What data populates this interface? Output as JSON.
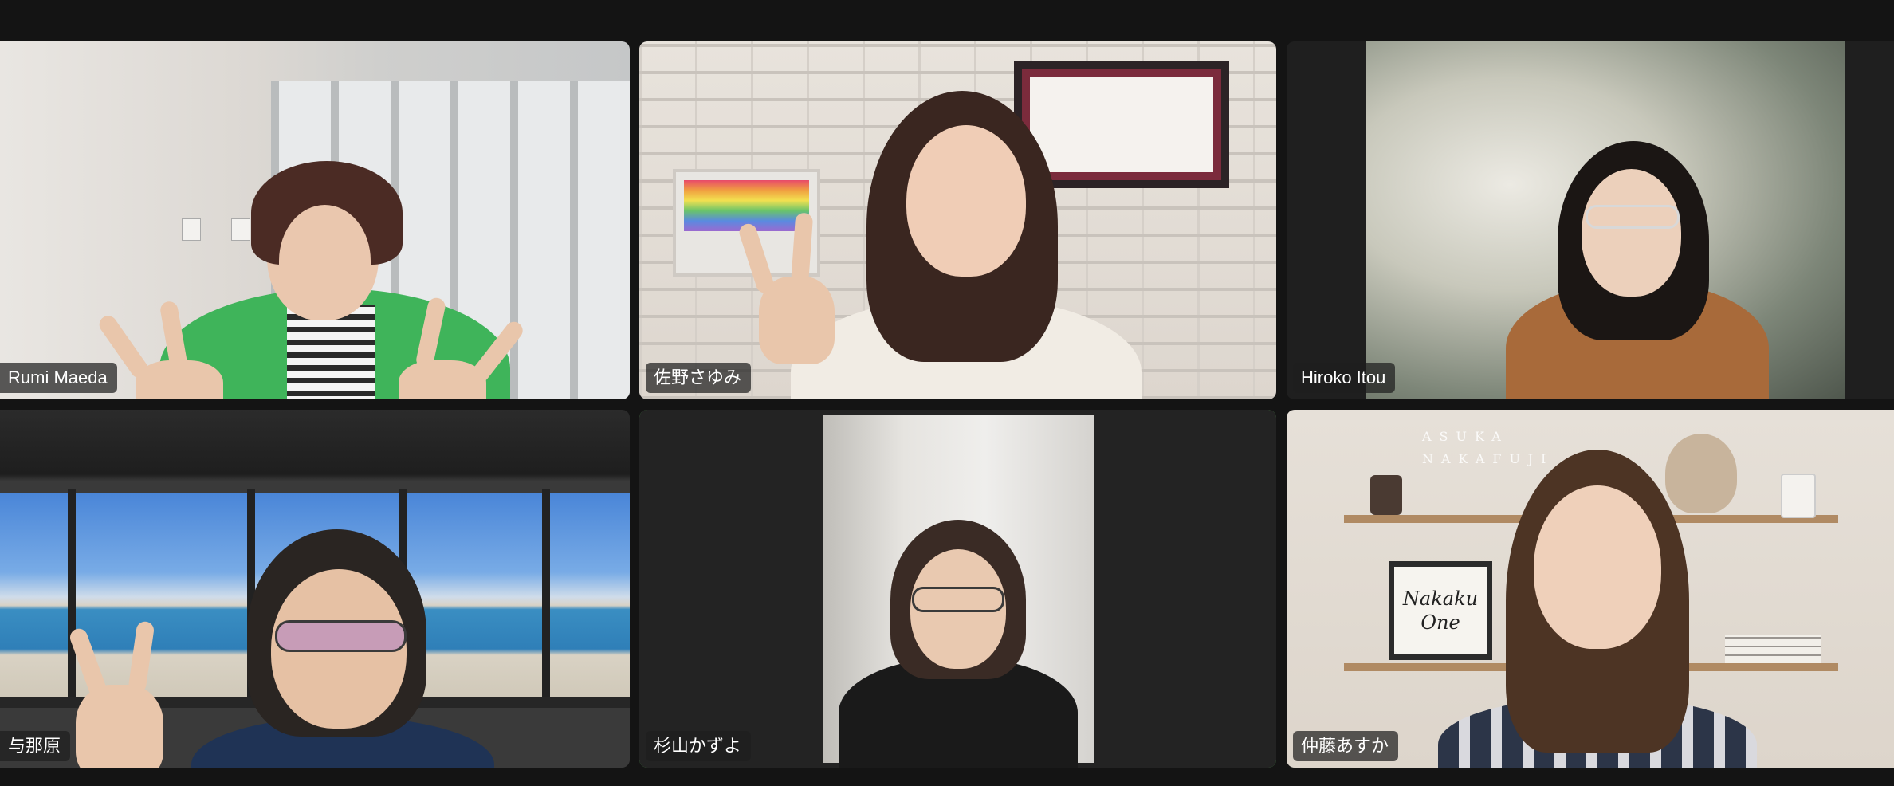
{
  "meeting": {
    "participants": [
      {
        "name": "Rumi Maeda"
      },
      {
        "name": "佐野さゆみ"
      },
      {
        "name": "Hiroko Itou"
      },
      {
        "name": "与那原"
      },
      {
        "name": "杉山かずよ",
        "active_speaker": true
      },
      {
        "name": "仲藤あすか"
      }
    ],
    "colors": {
      "background": "#141414",
      "active_speaker_border": "#5fd35a",
      "name_tag_bg": "#1e1e1e"
    }
  },
  "backgrounds": {
    "nakaku_sign_line1": "Nakaku",
    "nakaku_sign_line2": "One",
    "wall_letters": "ASUKA NAKAFUJI"
  }
}
